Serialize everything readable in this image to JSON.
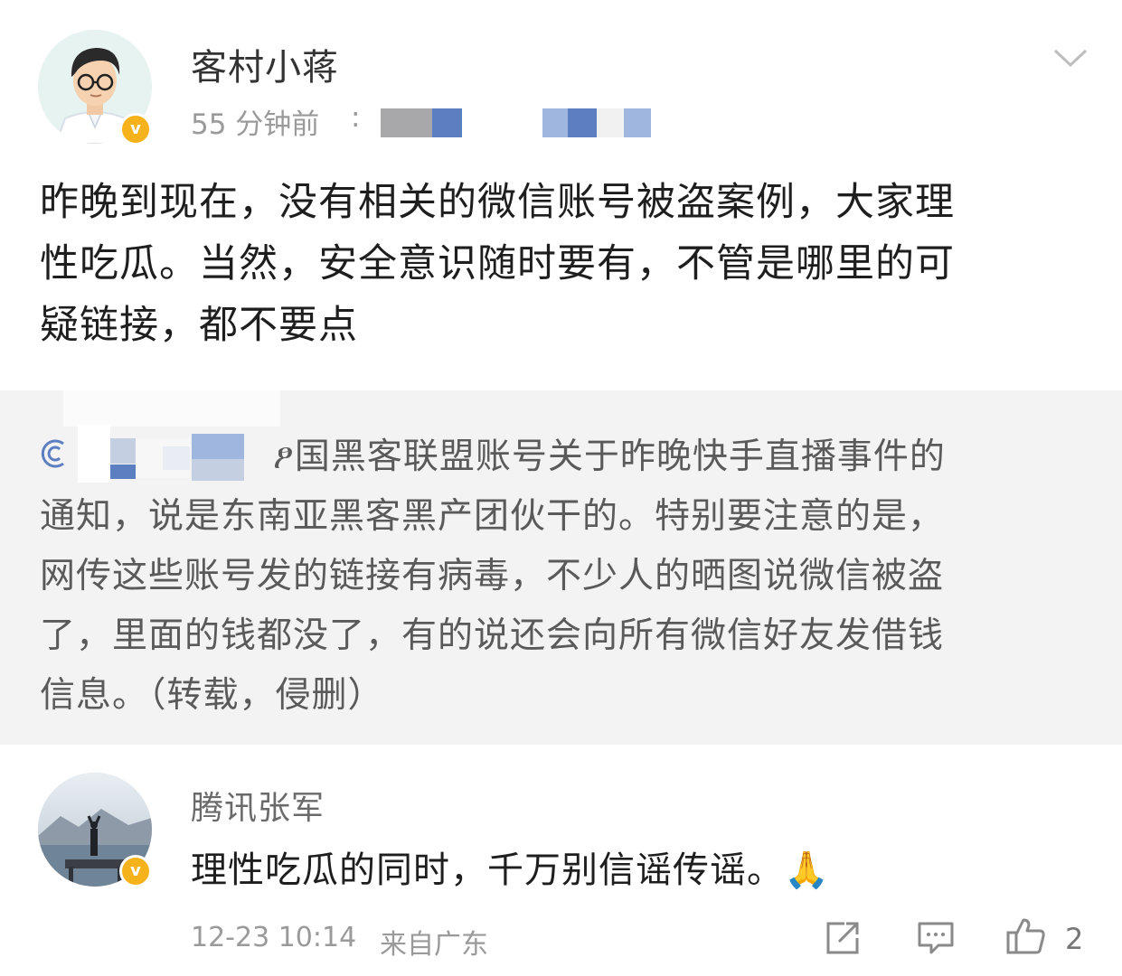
{
  "post": {
    "author_name": "客村小蒋",
    "verified_badge": "v",
    "time": "55 分钟前",
    "time_separator": ":",
    "text": "昨晚到现在，没有相关的微信账号被盗案例，大家理性吃瓜。当然，安全意识随时要有，不管是哪里的可疑链接，都不要点",
    "text_lines": [
      "昨晚到现在，没有相关的微信账号被盗案例，大家理",
      "性吃瓜。当然，安全意识随时要有，不管是哪里的可",
      "疑链接，都不要点"
    ]
  },
  "repost": {
    "lines": [
      "ፆ国黑客联盟账号关于昨晚快手直播事件的",
      "通知，说是东南亚黑客黑产团伙干的。特别要注意的是，",
      "网传这些账号发的链接有病毒，不少人的晒图说微信被盗",
      "了，里面的钱都没了，有的说还会向所有微信好友发借钱",
      "信息。（转载，侵删）"
    ]
  },
  "comment": {
    "author_name": "腾讯张军",
    "verified_badge": "v",
    "text": "理性吃瓜的同时，千万别信谣传谣。🙏",
    "date": "12-23 10:14",
    "source": "来自广东",
    "like_count": "2"
  },
  "icons": {
    "dropdown": "chevron-down-icon",
    "share": "share-icon",
    "comment": "comment-icon",
    "like": "thumbs-up-icon",
    "link": "link-icon"
  },
  "colors": {
    "badge": "#f6b21b",
    "repost_background": "#f3f3f4",
    "blur_blue": "#5b7fc0"
  }
}
